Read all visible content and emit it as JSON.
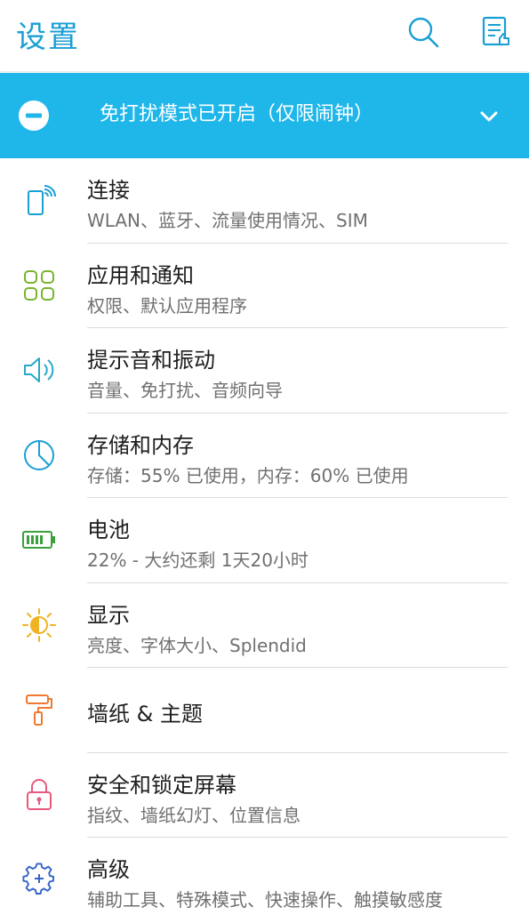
{
  "appbar": {
    "title": "设置",
    "accent_color": "#1a9fd4"
  },
  "banner": {
    "text": "免打扰模式已开启（仅限闹钟）",
    "bg_color": "#1fb6ea"
  },
  "items": [
    {
      "title": "连接",
      "subtitle": "WLAN、蓝牙、流量使用情况、SIM",
      "icon": "phone-wireless-icon",
      "icon_color": "#1a9fd4"
    },
    {
      "title": "应用和通知",
      "subtitle": "权限、默认应用程序",
      "icon": "apps-grid-icon",
      "icon_color": "#7ab32e"
    },
    {
      "title": "提示音和振动",
      "subtitle": "音量、免打扰、音频向导",
      "icon": "speaker-icon",
      "icon_color": "#26a9c9"
    },
    {
      "title": "存储和内存",
      "subtitle": "存储：55% 已使用，内存：60% 已使用",
      "icon": "pie-chart-icon",
      "icon_color": "#1a9fd4"
    },
    {
      "title": "电池",
      "subtitle": "22% - 大约还剩 1天20小时",
      "icon": "battery-icon",
      "icon_color": "#3aa03a"
    },
    {
      "title": "显示",
      "subtitle": "亮度、字体大小、Splendid",
      "icon": "brightness-icon",
      "icon_color": "#f0b323"
    },
    {
      "title": "墙纸 & 主题",
      "subtitle": "",
      "icon": "paint-roller-icon",
      "icon_color": "#ee7a32"
    },
    {
      "title": "安全和锁定屏幕",
      "subtitle": "指纹、墙纸幻灯、位置信息",
      "icon": "lock-icon",
      "icon_color": "#e55a7e"
    },
    {
      "title": "高级",
      "subtitle": "辅助工具、特殊模式、快速操作、触摸敏感度",
      "icon": "gear-plus-icon",
      "icon_color": "#3565c9"
    }
  ]
}
